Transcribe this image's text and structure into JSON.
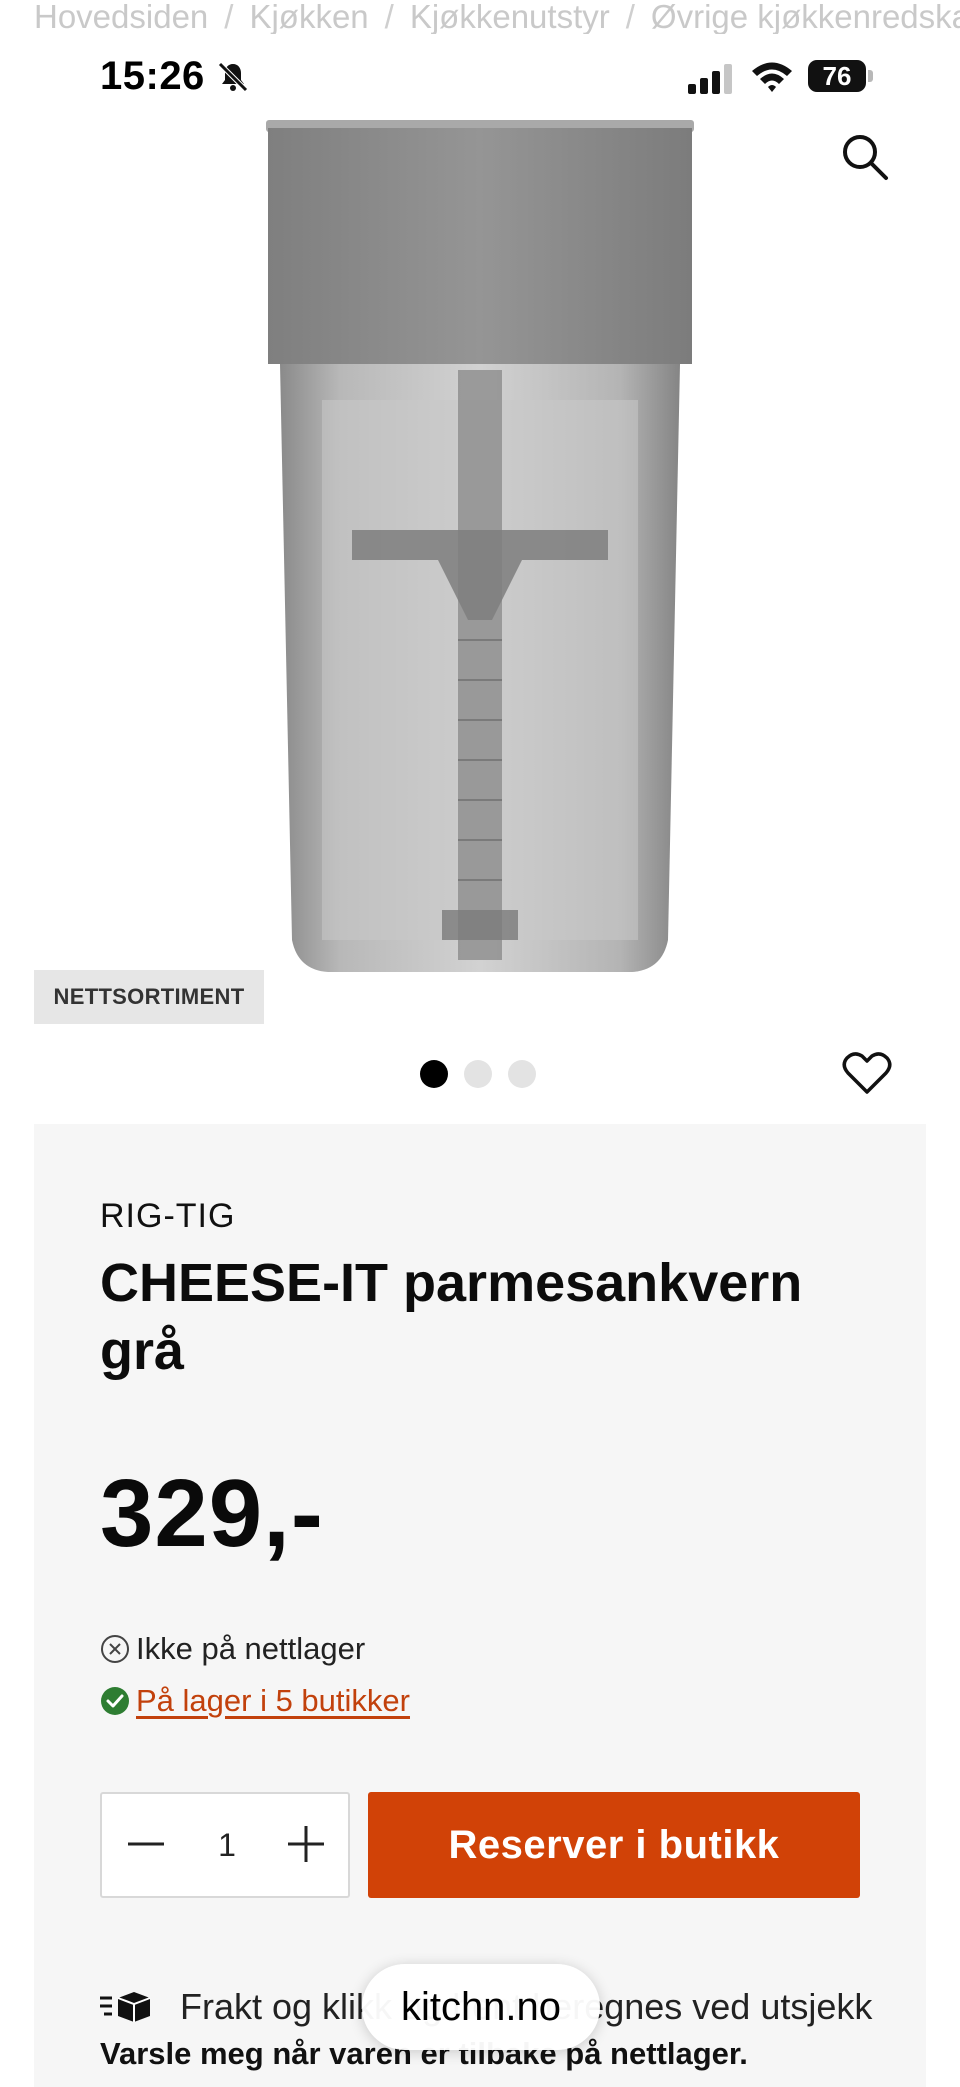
{
  "breadcrumb": [
    "Hovedsiden",
    "Kjøkken",
    "Kjøkkenutstyr",
    "Øvrige kjøkkenredskaper"
  ],
  "breadcrumb_separator": "/",
  "status_bar": {
    "time": "15:26",
    "battery": "76"
  },
  "product": {
    "badge": "NETTSORTIMENT",
    "image_count": 3,
    "active_image": 1,
    "brand": "RIG-TIG",
    "title": "CHEESE-IT parmesankvern grå",
    "price": "329,-",
    "online_stock": "Ikke på nettlager",
    "store_stock": "På lager i 5 butikker",
    "quantity": "1"
  },
  "actions": {
    "reserve_label": "Reserver i butikk"
  },
  "footer_info": {
    "shipping_text": "Frakt og klikk og hent beregnes ved utsjekk",
    "notify_text": "Varsle meg når varen er tilbake på nettlager."
  },
  "browser": {
    "url": "kitchn.no"
  },
  "colors": {
    "accent": "#d14207",
    "link": "#c2410c",
    "in_stock": "#2e7d32",
    "panel": "#f6f6f6"
  },
  "icons": [
    "bell-slash-icon",
    "signal-icon",
    "wifi-icon",
    "battery-icon",
    "search-icon",
    "heart-icon",
    "x-circle-icon",
    "check-circle-icon",
    "minus-icon",
    "plus-icon",
    "box-icon"
  ]
}
